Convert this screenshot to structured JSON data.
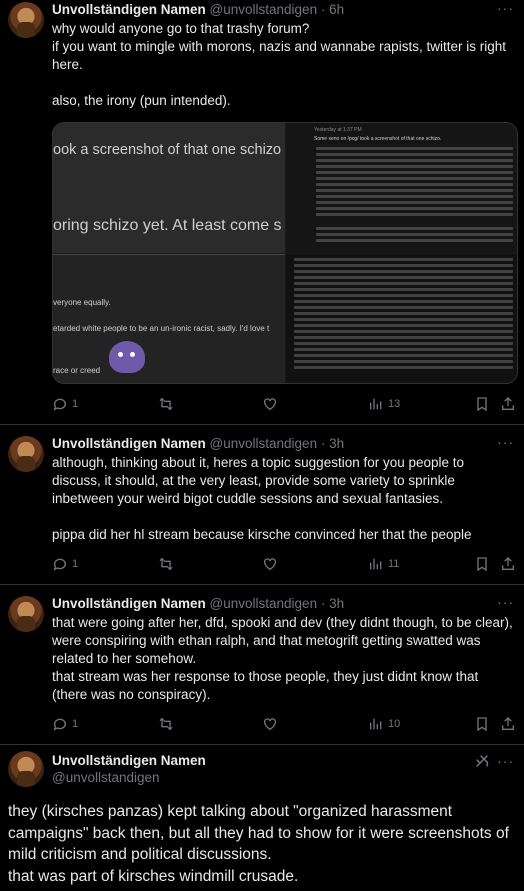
{
  "tweets": [
    {
      "name": "Unvollständigen Namen",
      "handle": "@unvollstandigen",
      "time": "· 6h",
      "text": "why would anyone go to that trashy forum?\nif you want to mingle with morons, nazis and wannabe rapists, twitter is right here.\n\nalso, the irony (pun intended).",
      "replies": "1",
      "retweets": "",
      "likes": "",
      "views": "13"
    },
    {
      "name": "Unvollständigen Namen",
      "handle": "@unvollstandigen",
      "time": "· 3h",
      "text": "although, thinking about it, heres a topic suggestion for you people to discuss, it should, at the very least, provide some variety to sprinkle inbetween your weird bigot cuddle sessions and sexual fantasies.\n\npippa did her hl stream because kirsche convinced her that the people",
      "replies": "1",
      "retweets": "",
      "likes": "",
      "views": "11"
    },
    {
      "name": "Unvollständigen Namen",
      "handle": "@unvollstandigen",
      "time": "· 3h",
      "text": "that were going after her, dfd, spooki and dev (they didnt though, to be clear), were conspiring with ethan ralph, and that metogrift getting swatted was related to her somehow.\nthat stream was her response to those people, they just didnt know that (there was no conspiracy).",
      "replies": "1",
      "retweets": "",
      "likes": "",
      "views": "10"
    }
  ],
  "media": {
    "top_left_line1": "ook a screenshot of that one schizo",
    "top_left_line2": "oring schizo yet. At least come s",
    "bottom_left_line1": "veryone equally.",
    "bottom_left_line2": "etarded white people to be an un-ironic racist, sadly. I'd love t",
    "bottom_left_line3": "race or creed",
    "top_right_header": "Yesterday at 1:37 PM",
    "top_right_quote": "Some xeno on /pcg/ took a screenshot of that one schizo."
  },
  "focus_tweet": {
    "name": "Unvollständigen Namen",
    "handle": "@unvollstandigen",
    "text": "they (kirsches panzas) kept talking about \"organized harassment campaigns\" back then, but all they had to show for it were screenshots of mild criticism and political discussions.\nthat was part of kirsches windmill crusade."
  },
  "icons": {
    "more": "more-icon",
    "reply": "reply-icon",
    "retweet": "retweet-icon",
    "like": "like-icon",
    "views": "views-icon",
    "bookmark": "bookmark-icon",
    "share": "share-icon",
    "grok": "grok-icon"
  }
}
